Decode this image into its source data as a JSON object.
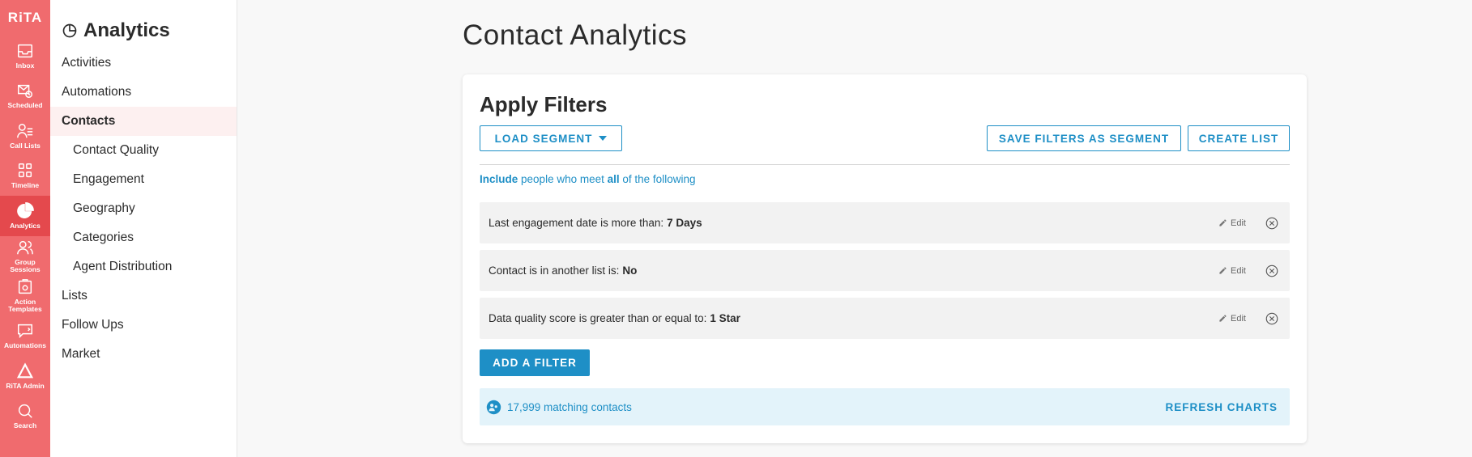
{
  "rail": {
    "logo": "RiTA",
    "items": [
      {
        "label": "Inbox",
        "icon": "inbox-icon"
      },
      {
        "label": "Scheduled",
        "icon": "scheduled-icon"
      },
      {
        "label": "Call Lists",
        "icon": "call-lists-icon"
      },
      {
        "label": "Timeline",
        "icon": "timeline-icon"
      },
      {
        "label": "Analytics",
        "icon": "analytics-icon",
        "active": true
      },
      {
        "label": "Group Sessions",
        "icon": "group-sessions-icon"
      },
      {
        "label": "Action Templates",
        "icon": "action-templates-icon"
      },
      {
        "label": "Automations",
        "icon": "automations-icon"
      },
      {
        "label": "RiTA Admin",
        "icon": "rita-admin-icon"
      },
      {
        "label": "Search",
        "icon": "search-icon"
      }
    ]
  },
  "subnav": {
    "title": "Analytics",
    "items": [
      {
        "label": "Activities"
      },
      {
        "label": "Automations"
      },
      {
        "label": "Contacts",
        "active": true
      },
      {
        "label": "Contact Quality",
        "sub": true
      },
      {
        "label": "Engagement",
        "sub": true
      },
      {
        "label": "Geography",
        "sub": true
      },
      {
        "label": "Categories",
        "sub": true
      },
      {
        "label": "Agent Distribution",
        "sub": true
      },
      {
        "label": "Lists"
      },
      {
        "label": "Follow Ups"
      },
      {
        "label": "Market"
      }
    ]
  },
  "main": {
    "title": "Contact Analytics",
    "card": {
      "title": "Apply Filters",
      "load_segment": "LOAD SEGMENT",
      "save_segment": "SAVE FILTERS AS SEGMENT",
      "create_list": "CREATE LIST",
      "rule": {
        "include": "Include",
        "text1": "people who meet",
        "all": "all",
        "text2": "of the following"
      },
      "filters": [
        {
          "text": "Last engagement date is more than:",
          "value": "7 Days",
          "edit": "Edit"
        },
        {
          "text": "Contact is in another list is:",
          "value": "No",
          "edit": "Edit"
        },
        {
          "text": "Data quality score is greater than or equal to:",
          "value": "1 Star",
          "edit": "Edit"
        }
      ],
      "add_filter": "ADD A FILTER",
      "matching": "17,999 matching contacts",
      "refresh": "REFRESH CHARTS"
    }
  },
  "colors": {
    "rail": "#f06b6e",
    "rail_active": "#e4494d",
    "accent": "#1e8fc6"
  }
}
